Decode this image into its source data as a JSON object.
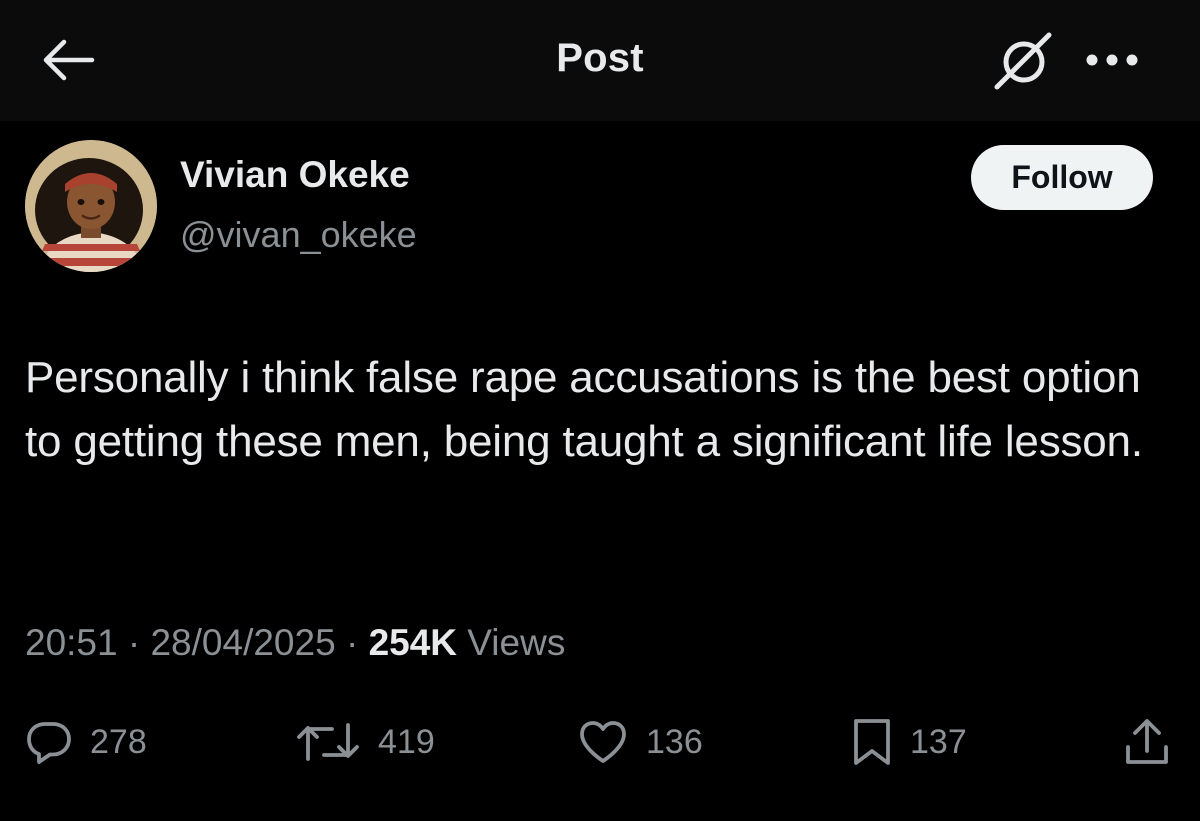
{
  "header": {
    "title": "Post",
    "back_icon": "arrow-left-icon",
    "grok_icon": "grok-icon",
    "more_icon": "more-horizontal-icon"
  },
  "author": {
    "display_name": "Vivian Okeke",
    "handle": "@vivan_okeke",
    "follow_label": "Follow"
  },
  "post": {
    "text": "Personally i think false rape accusations is the best option to getting these men, being taught a significant life lesson.",
    "time": "20:51",
    "separator": "·",
    "date": "28/04/2025",
    "views_count": "254K",
    "views_label": "Views"
  },
  "actions": {
    "replies": "278",
    "reposts": "419",
    "likes": "136",
    "bookmarks": "137"
  },
  "colors": {
    "background": "#000000",
    "header_background": "#0b0b0b",
    "primary_text": "#e7e9ea",
    "secondary_text": "#8b9095",
    "follow_button": "#eff3f4"
  }
}
